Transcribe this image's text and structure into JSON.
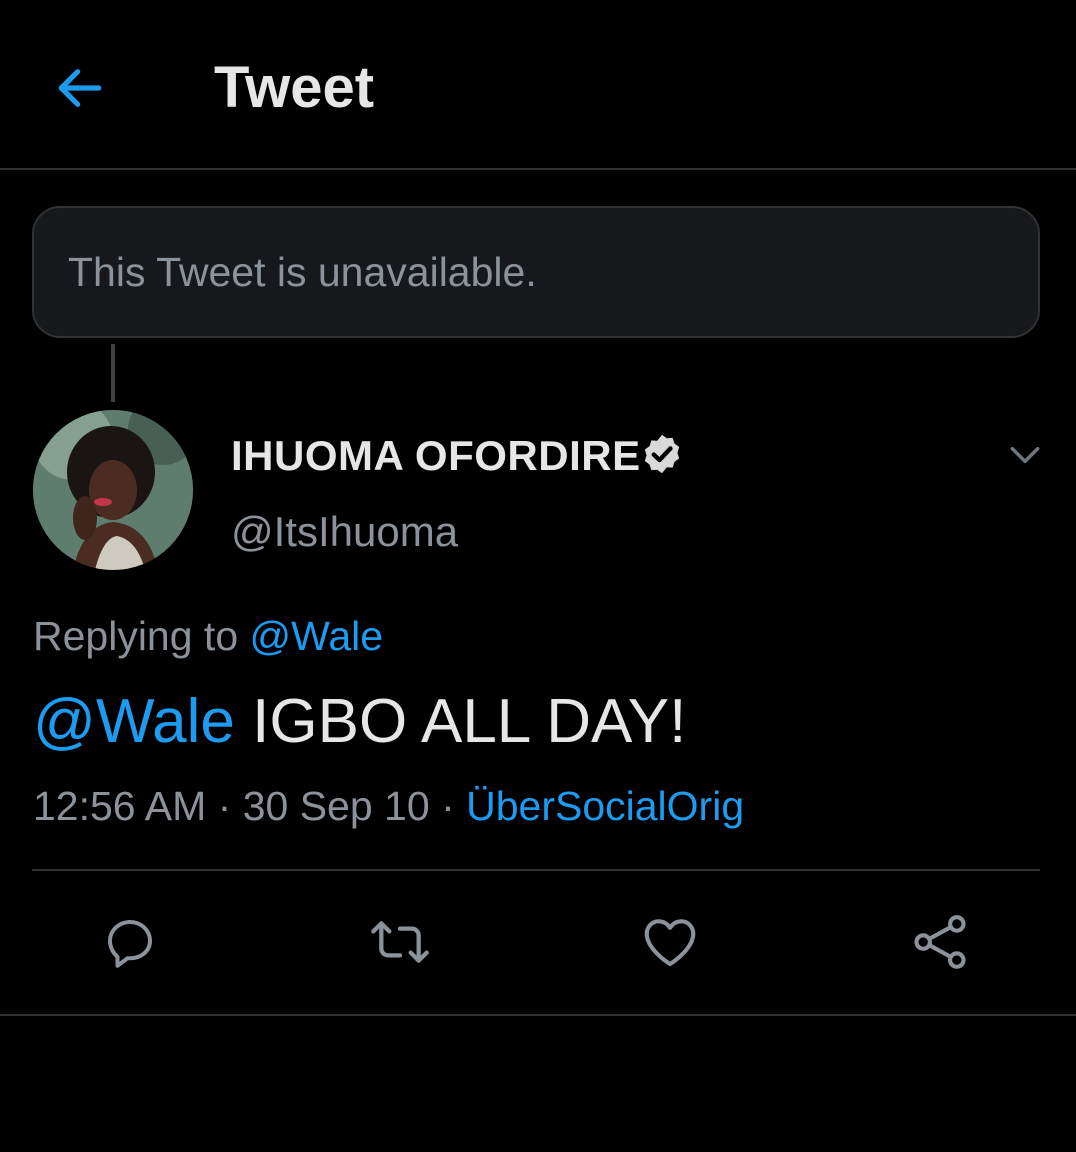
{
  "header": {
    "title": "Tweet",
    "back_icon": "arrow-left-icon",
    "accent_color": "#1d9bf0"
  },
  "unavailable": {
    "message": "This Tweet is unavailable."
  },
  "tweet": {
    "author": {
      "display_name": "IHUOMA OFORDIRE",
      "handle": "@ItsIhuoma",
      "verified_icon": "verified-badge-icon"
    },
    "replying_label": "Replying to",
    "replying_to": "@Wale",
    "mention": "@Wale",
    "body": "IGBO ALL DAY!",
    "time": "12:56 AM",
    "separator": "·",
    "date": "30 Sep 10",
    "source": "ÜberSocialOrig"
  },
  "actions": [
    {
      "icon": "reply-icon"
    },
    {
      "icon": "retweet-icon"
    },
    {
      "icon": "like-icon"
    },
    {
      "icon": "share-icon"
    }
  ]
}
